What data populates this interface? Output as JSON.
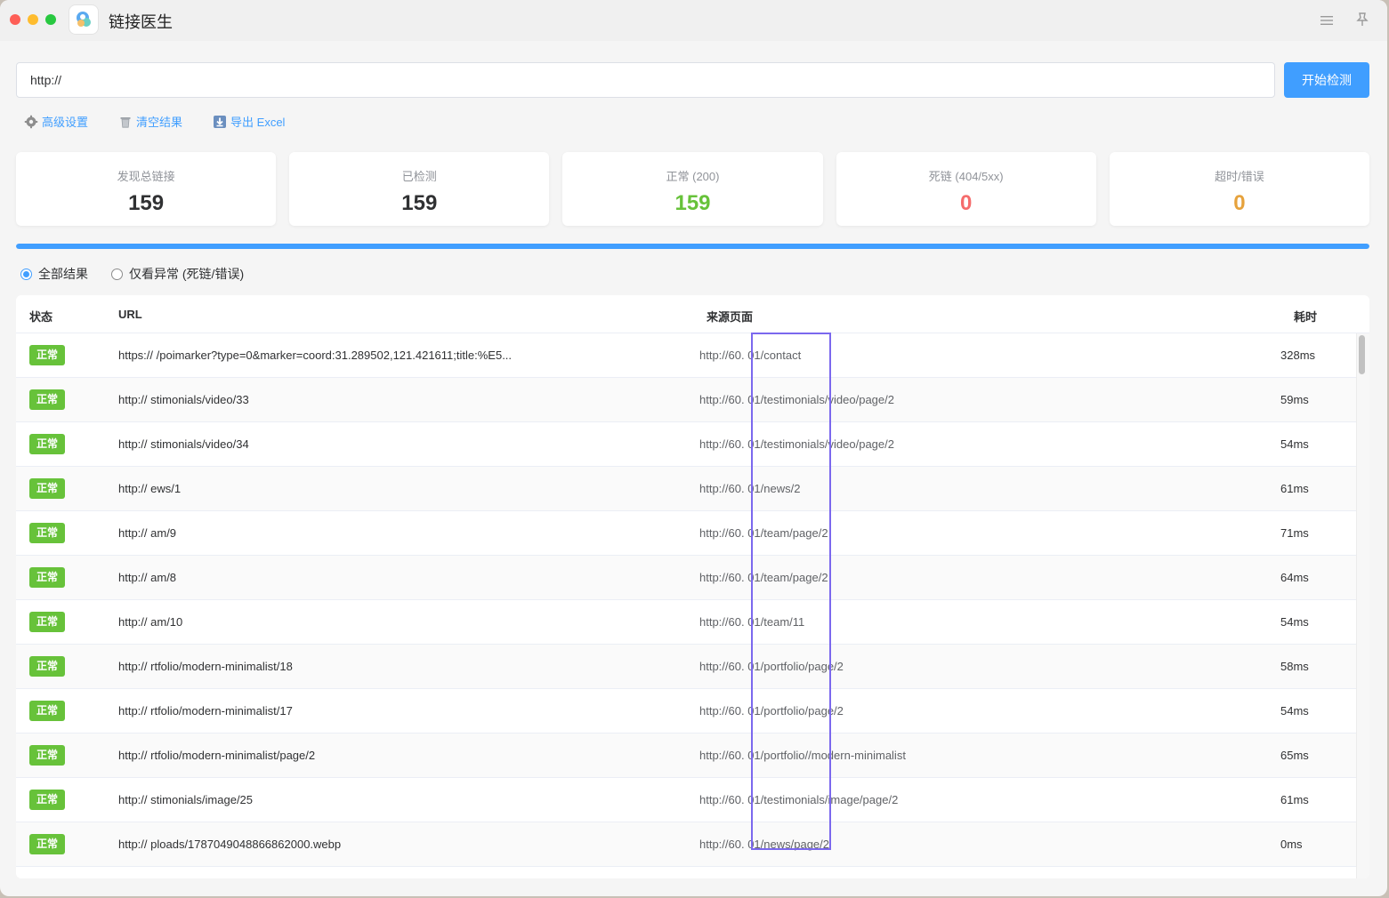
{
  "app": {
    "title": "链接医生"
  },
  "colors": {
    "accent": "#409eff",
    "success": "#67c23a",
    "danger": "#f56c6c",
    "warning": "#e6a23c"
  },
  "url_input": {
    "value": "http://"
  },
  "start_button": {
    "label": "开始检测"
  },
  "toolbar": {
    "advanced_label": "高级设置",
    "clear_label": "清空结果",
    "export_label": "导出 Excel"
  },
  "stats": [
    {
      "label": "发现总链接",
      "value": "159",
      "color": "#303133"
    },
    {
      "label": "已检测",
      "value": "159",
      "color": "#303133"
    },
    {
      "label": "正常 (200)",
      "value": "159",
      "color": "#67c23a"
    },
    {
      "label": "死链 (404/5xx)",
      "value": "0",
      "color": "#f56c6c"
    },
    {
      "label": "超时/错误",
      "value": "0",
      "color": "#e6a23c"
    }
  ],
  "progress": {
    "percent": 100
  },
  "filters": {
    "all_label": "全部结果",
    "abnormal_label": "仅看异常 (死链/错误)",
    "selected": "all"
  },
  "table": {
    "headers": {
      "status": "状态",
      "url": "URL",
      "source": "来源页面",
      "time": "耗时"
    },
    "rows": [
      {
        "status": "正常",
        "url": "https://                /poimarker?type=0&marker=coord:31.289502,121.421611;title:%E5...",
        "source": "http://60.                01/contact",
        "time": "328ms"
      },
      {
        "status": "正常",
        "url": "http://                stimonials/video/33",
        "source": "http://60.                01/testimonials/video/page/2",
        "time": "59ms"
      },
      {
        "status": "正常",
        "url": "http://                stimonials/video/34",
        "source": "http://60.                01/testimonials/video/page/2",
        "time": "54ms"
      },
      {
        "status": "正常",
        "url": "http://                ews/1",
        "source": "http://60.                01/news/2",
        "time": "61ms"
      },
      {
        "status": "正常",
        "url": "http://                am/9",
        "source": "http://60.                01/team/page/2",
        "time": "71ms"
      },
      {
        "status": "正常",
        "url": "http://                am/8",
        "source": "http://60.                01/team/page/2",
        "time": "64ms"
      },
      {
        "status": "正常",
        "url": "http://                am/10",
        "source": "http://60.                01/team/11",
        "time": "54ms"
      },
      {
        "status": "正常",
        "url": "http://                rtfolio/modern-minimalist/18",
        "source": "http://60.                01/portfolio/page/2",
        "time": "58ms"
      },
      {
        "status": "正常",
        "url": "http://                rtfolio/modern-minimalist/17",
        "source": "http://60.                01/portfolio/page/2",
        "time": "54ms"
      },
      {
        "status": "正常",
        "url": "http://                rtfolio/modern-minimalist/page/2",
        "source": "http://60.                01/portfolio//modern-minimalist",
        "time": "65ms"
      },
      {
        "status": "正常",
        "url": "http://                stimonials/image/25",
        "source": "http://60.                01/testimonials/image/page/2",
        "time": "61ms"
      },
      {
        "status": "正常",
        "url": "http://                ploads/1787049048866862000.webp",
        "source": "http://60.                01/news/page/2",
        "time": "0ms"
      }
    ]
  }
}
